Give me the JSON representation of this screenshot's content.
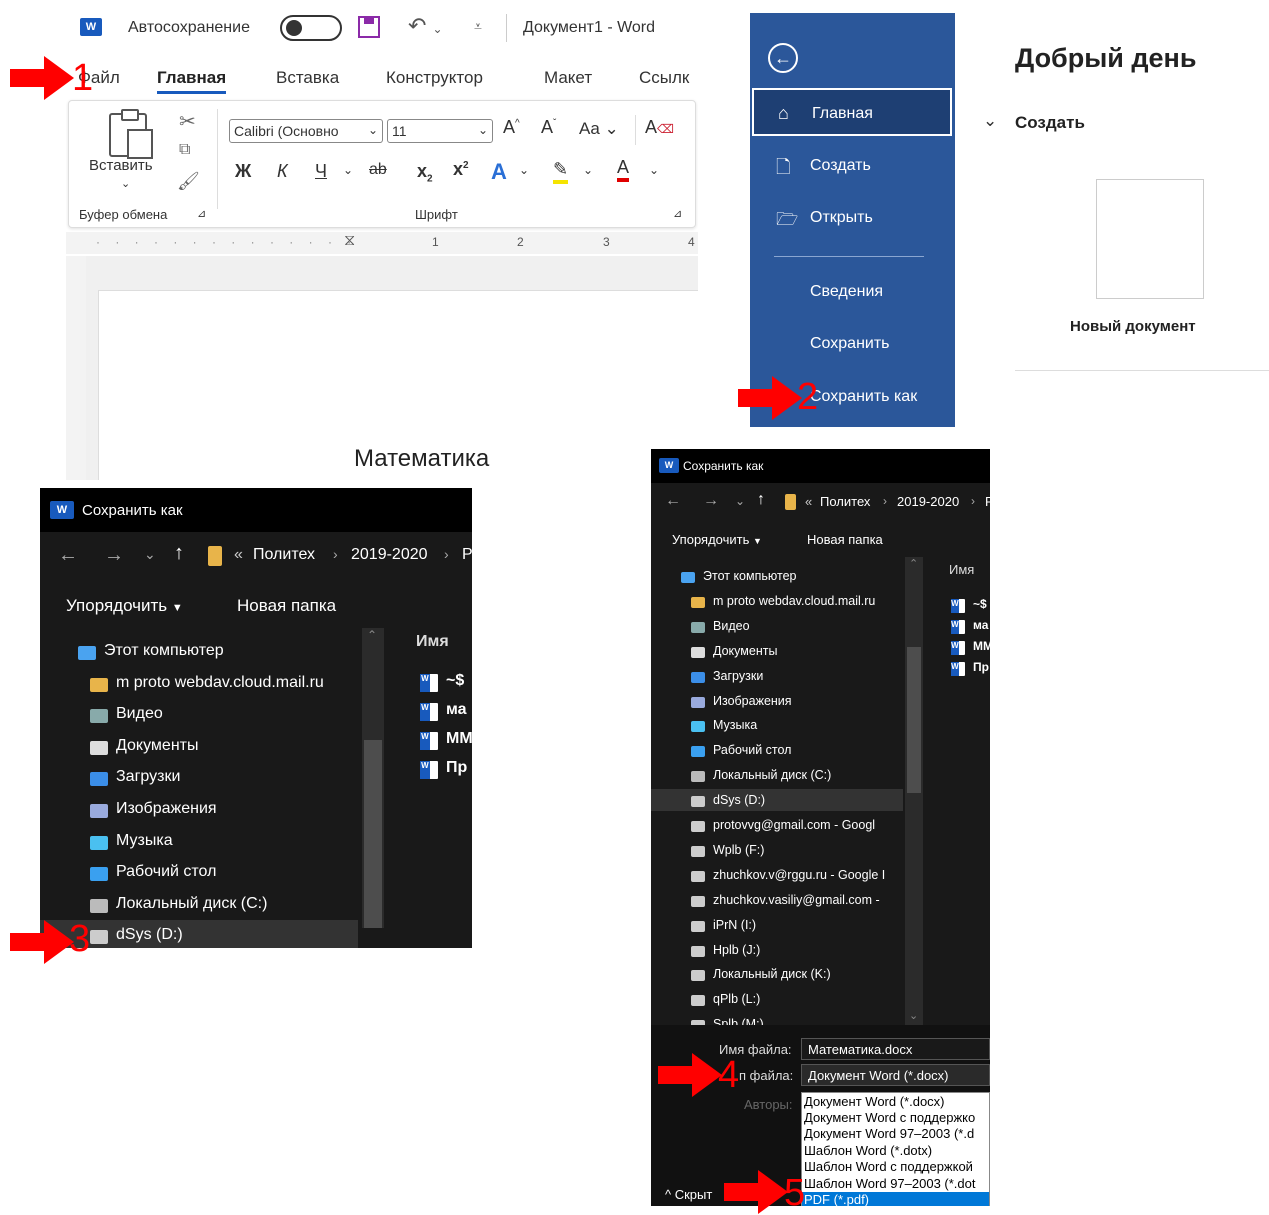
{
  "panel1": {
    "autosave_label": "Автосохранение",
    "doc_title": "Документ1 - Word",
    "tabs": [
      "Файл",
      "Главная",
      "Вставка",
      "Конструктор",
      "Макет",
      "Ссылк"
    ],
    "paste_label": "Вставить",
    "clipboard_group": "Буфер обмена",
    "font_group": "Шрифт",
    "font_name": "Calibri (Основно",
    "font_size": "11",
    "case_label": "Aa",
    "ruler_numbers": [
      "1",
      "2",
      "3",
      "4"
    ],
    "body_text": "Математика"
  },
  "panel2": {
    "nav_items": [
      "Главная",
      "Создать",
      "Открыть",
      "Сведения",
      "Сохранить",
      "Сохранить как"
    ],
    "greeting": "Добрый день",
    "create_heading": "Создать",
    "new_document": "Новый документ"
  },
  "dialog": {
    "title": "Сохранить как",
    "breadcrumb": [
      "Политех",
      "2019-2020",
      "Р"
    ],
    "organize": "Упорядочить",
    "new_folder": "Новая папка",
    "column_name": "Имя",
    "files": [
      "~$",
      "ма",
      "ММ",
      "Пр"
    ],
    "tree_short": [
      "Этот компьютер",
      "m proto webdav.cloud.mail.ru",
      "Видео",
      "Документы",
      "Загрузки",
      "Изображения",
      "Музыка",
      "Рабочий стол",
      "Локальный диск (C:)",
      "dSys (D:)"
    ],
    "tree_long": [
      "Этот компьютер",
      "m proto webdav.cloud.mail.ru",
      "Видео",
      "Документы",
      "Загрузки",
      "Изображения",
      "Музыка",
      "Рабочий стол",
      "Локальный диск (C:)",
      "dSys (D:)",
      "protovvg@gmail.com - Googl",
      "Wplb (F:)",
      "zhuchkov.v@rggu.ru - Google I",
      "zhuchkov.vasiliy@gmail.com -",
      "iPrN (I:)",
      "Hplb (J:)",
      "Локальный диск (K:)",
      "qPlb (L:)",
      "Splb (M:)"
    ],
    "filename_label": "Имя файла:",
    "filename_value": "Математика.docx",
    "filetype_label": "п файла:",
    "filetype_value": "Документ Word (*.docx)",
    "authors_label": "Авторы:",
    "hide_label": "Скрыт",
    "filetype_options": [
      "Документ Word (*.docx)",
      "Документ Word с поддержко",
      "Документ Word 97–2003 (*.d",
      "Шаблон Word (*.dotx)",
      "Шаблон Word с поддержкой",
      "Шаблон Word 97–2003 (*.dot",
      "PDF (*.pdf)"
    ]
  },
  "steps": [
    "1",
    "2",
    "3",
    "4",
    "5"
  ],
  "colors": {
    "word_blue": "#185abd",
    "backstage_blue": "#2b579a",
    "arrow_red": "#ff0000",
    "dialog_bg": "#191919"
  }
}
